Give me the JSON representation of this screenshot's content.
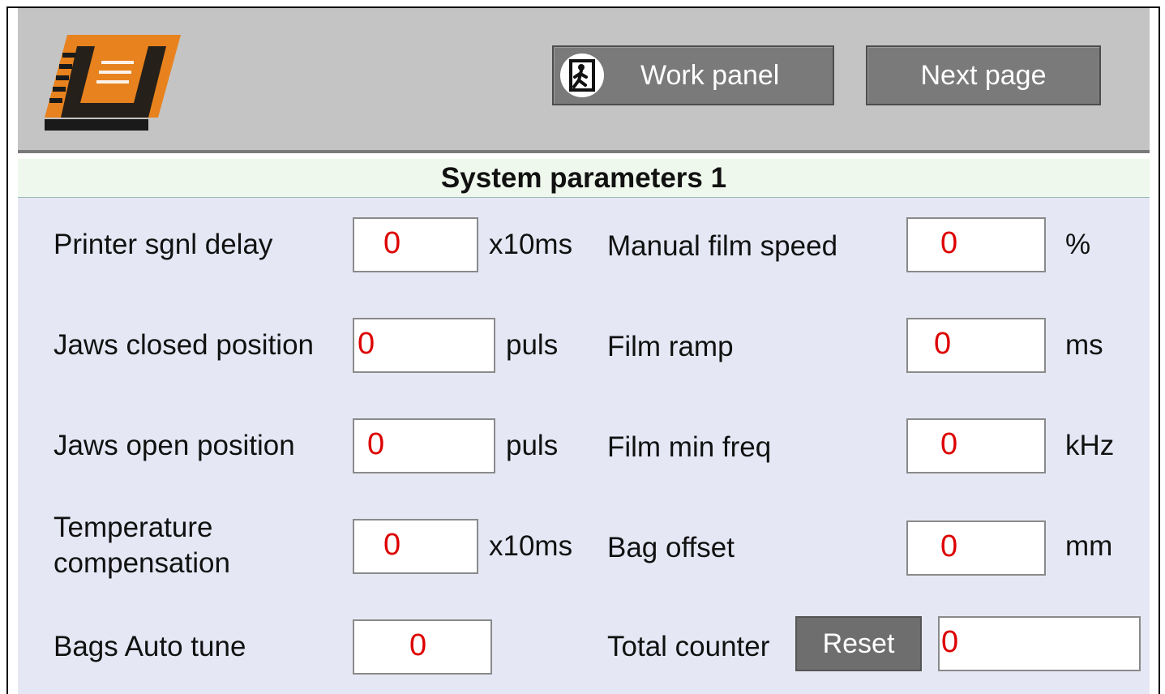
{
  "header": {
    "logo_alt": "LU",
    "work_panel_label": "Work panel",
    "next_page_label": "Next page"
  },
  "title": "System parameters 1",
  "params_left": [
    {
      "label": "Printer sgnl delay",
      "value": "0",
      "unit": "x10ms"
    },
    {
      "label": "Jaws closed position",
      "value": "0",
      "unit": "puls"
    },
    {
      "label": "Jaws open position",
      "value": "0",
      "unit": "puls"
    },
    {
      "label_line1": "Temperature",
      "label_line2": "compensation",
      "value": "0",
      "unit": "x10ms"
    },
    {
      "label": "Bags Auto tune",
      "value": "0"
    }
  ],
  "params_right": [
    {
      "label": "Manual film speed",
      "value": "0",
      "unit": "%"
    },
    {
      "label": "Film ramp",
      "value": "0",
      "unit": "ms"
    },
    {
      "label": "Film min freq",
      "value": "0",
      "unit": "kHz"
    },
    {
      "label": "Bag offset",
      "value": "0",
      "unit": "mm"
    },
    {
      "label": "Total counter",
      "value": "0",
      "reset_label": "Reset"
    }
  ],
  "colors": {
    "header_bg": "#c4c4c4",
    "content_bg": "#e5e8f4",
    "value_text": "#dd0000",
    "logo_orange": "#e8821e"
  },
  "icons": {
    "work_panel": "emergency-exit-icon"
  }
}
